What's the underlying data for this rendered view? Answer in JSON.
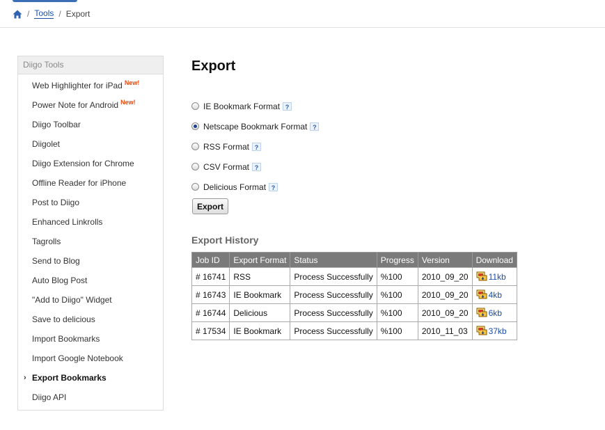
{
  "breadcrumb": {
    "home_icon": "home-icon",
    "separator": "/",
    "items": [
      "Tools",
      "Export"
    ]
  },
  "sidebar": {
    "title": "Diigo Tools",
    "new_badge": "New!",
    "items": [
      {
        "label": "Web Highlighter for iPad",
        "new": true
      },
      {
        "label": "Power Note for Android",
        "new": true
      },
      {
        "label": "Diigo Toolbar"
      },
      {
        "label": "Diigolet"
      },
      {
        "label": "Diigo Extension for Chrome"
      },
      {
        "label": "Offline Reader for iPhone"
      },
      {
        "label": "Post to Diigo"
      },
      {
        "label": "Enhanced Linkrolls"
      },
      {
        "label": "Tagrolls"
      },
      {
        "label": "Send to Blog"
      },
      {
        "label": "Auto Blog Post"
      },
      {
        "label": "\"Add to Diigo\" Widget"
      },
      {
        "label": "Save to delicious"
      },
      {
        "label": "Import Bookmarks"
      },
      {
        "label": "Import Google Notebook"
      },
      {
        "label": "Export Bookmarks",
        "active": true
      },
      {
        "label": "Diigo API"
      }
    ],
    "active_marker": "›"
  },
  "main": {
    "title": "Export",
    "help_label": "?",
    "formats": [
      {
        "label": "IE Bookmark Format",
        "checked": false
      },
      {
        "label": "Netscape Bookmark Format",
        "checked": true
      },
      {
        "label": "RSS Format",
        "checked": false
      },
      {
        "label": "CSV Format",
        "checked": false
      },
      {
        "label": "Delicious Format",
        "checked": false
      }
    ],
    "export_button": "Export"
  },
  "history": {
    "title": "Export History",
    "columns": [
      "Job ID",
      "Export Format",
      "Status",
      "Progress",
      "Version",
      "Download"
    ],
    "rows": [
      [
        "# 16741",
        "RSS",
        "Process Successfully",
        "%100",
        "2010_09_20",
        "11kb"
      ],
      [
        "# 16743",
        "IE Bookmark",
        "Process Successfully",
        "%100",
        "2010_09_20",
        "4kb"
      ],
      [
        "# 16744",
        "Delicious",
        "Process Successfully",
        "%100",
        "2010_09_20",
        "6kb"
      ],
      [
        "# 17534",
        "IE Bookmark",
        "Process Successfully",
        "%100",
        "2010_11_03",
        "37kb"
      ]
    ]
  },
  "colors": {
    "link": "#1a4fa8",
    "new_badge": "#e8490f",
    "table_header_bg": "#7a7a7a"
  }
}
